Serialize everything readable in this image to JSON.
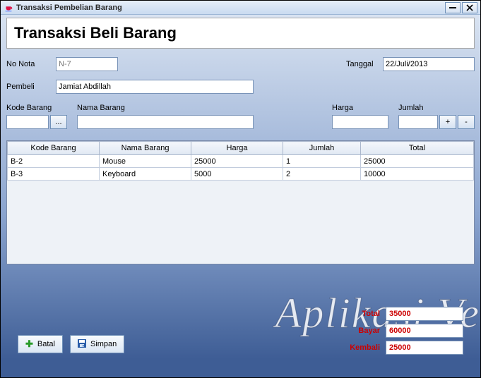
{
  "window": {
    "title": "Transaksi Pembelian Barang"
  },
  "header": {
    "title": "Transaksi Beli Barang"
  },
  "form": {
    "no_nota_label": "No Nota",
    "no_nota_placeholder": "N-7",
    "tanggal_label": "Tanggal",
    "tanggal_value": "22/Juli/2013",
    "pembeli_label": "Pembeli",
    "pembeli_value": "Jamiat Abdillah",
    "kode_label": "Kode Barang",
    "nama_label": "Nama Barang",
    "harga_label": "Harga",
    "jumlah_label": "Jumlah",
    "browse_label": "...",
    "plus_label": "+",
    "minus_label": "-"
  },
  "table": {
    "headers": {
      "kode": "Kode Barang",
      "nama": "Nama Barang",
      "harga": "Harga",
      "jumlah": "Jumlah",
      "total": "Total"
    },
    "rows": [
      {
        "kode": "B-2",
        "nama": "Mouse",
        "harga": "25000",
        "jumlah": "1",
        "total": "25000"
      },
      {
        "kode": "B-3",
        "nama": "Keyboard",
        "harga": "5000",
        "jumlah": "2",
        "total": "10000"
      }
    ]
  },
  "totals": {
    "total_label": "Total",
    "total_value": "35000",
    "bayar_label": "Bayar",
    "bayar_value": "60000",
    "kembali_label": "Kembali",
    "kembali_value": "25000"
  },
  "actions": {
    "batal": "Batal",
    "simpan": "Simpan"
  },
  "watermark": "Aplikasi Ve"
}
